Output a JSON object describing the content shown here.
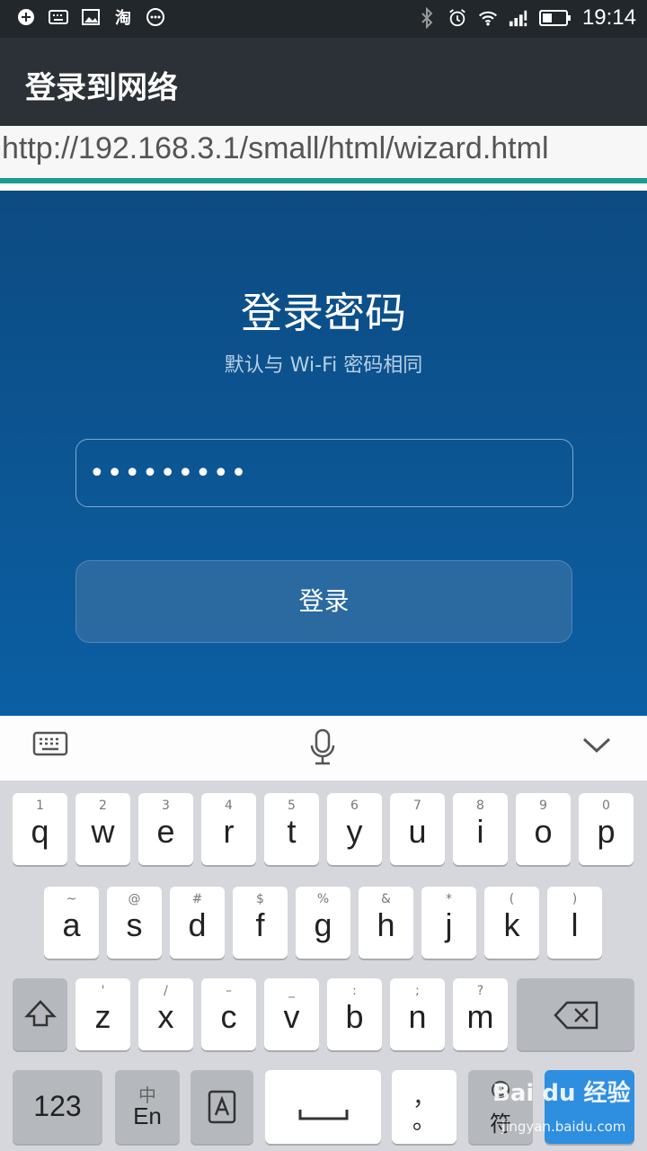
{
  "status_bar": {
    "time": "19:14",
    "left_icons": [
      "vpn-icon",
      "keyboard-icon",
      "image-icon",
      "taobao-icon",
      "more-icon"
    ],
    "right_icons": [
      "bluetooth-icon",
      "alarm-icon",
      "wifi-icon",
      "signal-icon",
      "battery-icon"
    ],
    "taobao_glyph": "淘"
  },
  "app_bar": {
    "title": "登录到网络"
  },
  "url_bar": {
    "url": "http://192.168.3.1/small/html/wizard.html"
  },
  "login": {
    "title": "登录密码",
    "subtitle": "默认与 Wi-Fi 密码相同",
    "password_value": "•••••••••",
    "button_label": "登录"
  },
  "keyboard": {
    "row1": [
      {
        "hint": "1",
        "key": "q"
      },
      {
        "hint": "2",
        "key": "w"
      },
      {
        "hint": "3",
        "key": "e"
      },
      {
        "hint": "4",
        "key": "r"
      },
      {
        "hint": "5",
        "key": "t"
      },
      {
        "hint": "6",
        "key": "y"
      },
      {
        "hint": "7",
        "key": "u"
      },
      {
        "hint": "8",
        "key": "i"
      },
      {
        "hint": "9",
        "key": "o"
      },
      {
        "hint": "0",
        "key": "p"
      }
    ],
    "row2": [
      {
        "hint": "~",
        "key": "a"
      },
      {
        "hint": "@",
        "key": "s"
      },
      {
        "hint": "#",
        "key": "d"
      },
      {
        "hint": "$",
        "key": "f"
      },
      {
        "hint": "%",
        "key": "g"
      },
      {
        "hint": "&",
        "key": "h"
      },
      {
        "hint": "*",
        "key": "j"
      },
      {
        "hint": "(",
        "key": "k"
      },
      {
        "hint": ")",
        "key": "l"
      }
    ],
    "row3": [
      {
        "hint": "'",
        "key": "z"
      },
      {
        "hint": "/",
        "key": "x"
      },
      {
        "hint": "–",
        "key": "c"
      },
      {
        "hint": "_",
        "key": "v"
      },
      {
        "hint": ":",
        "key": "b"
      },
      {
        "hint": ";",
        "key": "n"
      },
      {
        "hint": "?",
        "key": "m"
      }
    ],
    "bottom": {
      "numbers": "123",
      "lang_top": "中",
      "lang_bottom": "En",
      "punct_top": "，",
      "punct_bottom": "。",
      "emoji_label": "符"
    }
  },
  "watermark": {
    "text": "Bai du 经验",
    "sub": "jingyan.baidu.com"
  }
}
